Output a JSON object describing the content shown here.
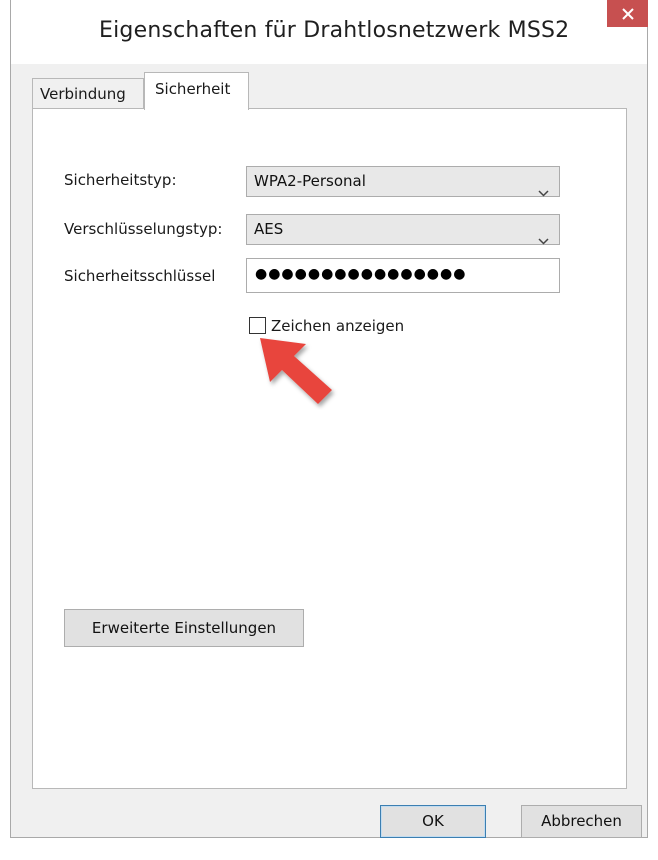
{
  "window": {
    "title": "Eigenschaften für Drahtlosnetzwerk MSS2",
    "close_icon": "close-icon",
    "close_color": "#c75050"
  },
  "tabs": [
    {
      "label": "Verbindung",
      "active": false
    },
    {
      "label": "Sicherheit",
      "active": true
    }
  ],
  "security": {
    "type_label": "Sicherheitstyp:",
    "type_value": "WPA2-Personal",
    "encryption_label": "Verschlüsselungstyp:",
    "encryption_value": "AES",
    "key_label": "Sicherheitsschlüssel",
    "key_value": "●●●●●●●●●●●●●●●●",
    "show_chars_label": "Zeichen anzeigen",
    "show_chars_checked": false
  },
  "advanced_button": "Erweiterte Einstellungen",
  "footer": {
    "ok_label": "OK",
    "cancel_label": "Abbrechen"
  },
  "annotation": {
    "arrow_icon": "pointer-arrow-icon",
    "arrow_color": "#e8453c"
  }
}
